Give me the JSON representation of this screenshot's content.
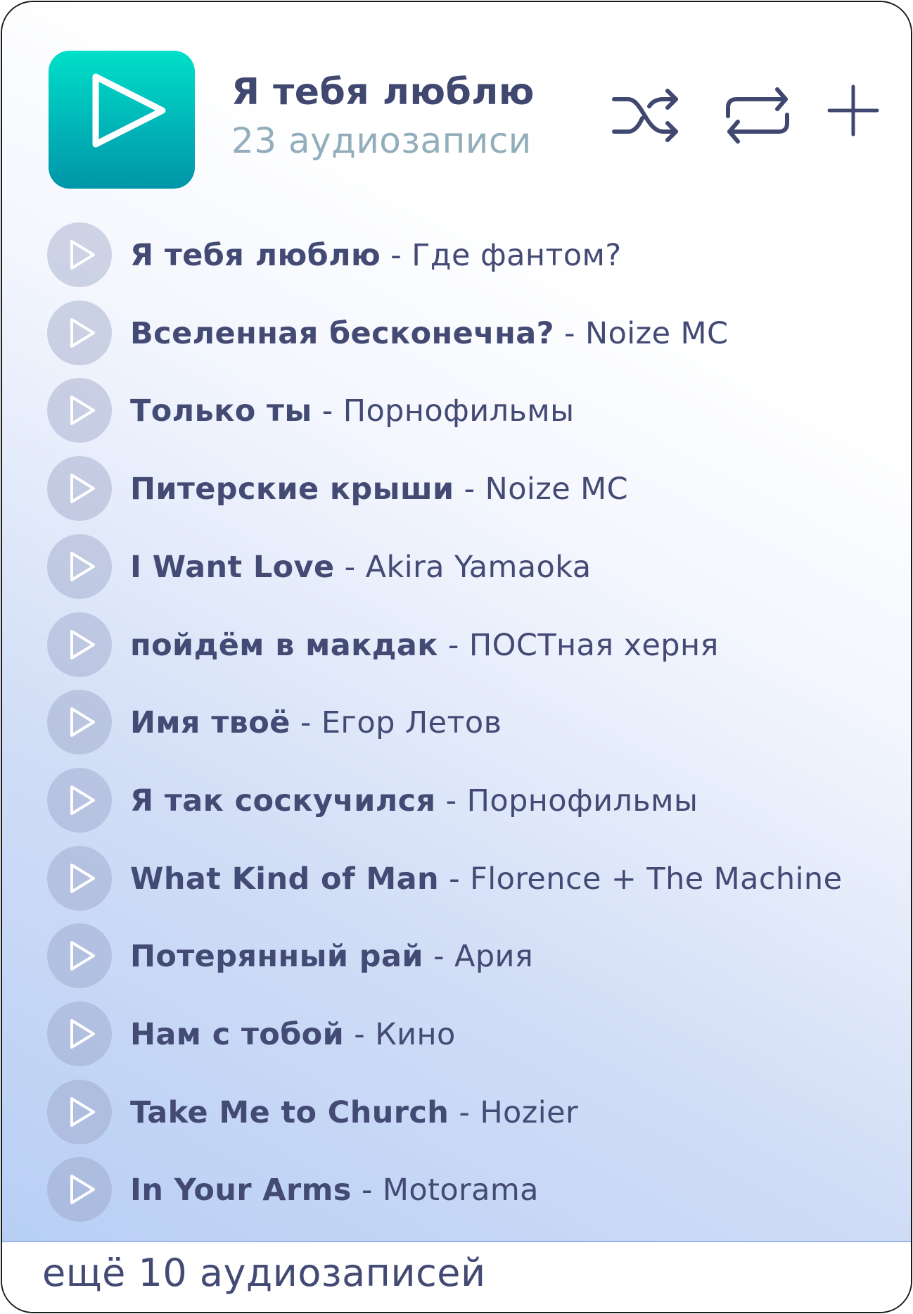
{
  "playlist": {
    "title": "Я тебя люблю",
    "count_label": "23 аудиозаписи"
  },
  "icons": {
    "cover": "play-icon",
    "shuffle": "shuffle-icon",
    "repeat": "repeat-icon",
    "add": "plus-icon",
    "row_play": "play-icon"
  },
  "colors": {
    "cover_top": "#00e0c8",
    "cover_bottom": "#0096a8",
    "title_text": "#414870",
    "subtitle_text": "#93aebb",
    "icon_stroke": "#414870",
    "divider": "#9ab5ea"
  },
  "separator": " - ",
  "tracks": [
    {
      "song": "Я тебя люблю",
      "artist": "Где фантом?"
    },
    {
      "song": "Вселенная бесконечна?",
      "artist": "Noize MC"
    },
    {
      "song": "Только ты",
      "artist": "Порнофильмы"
    },
    {
      "song": "Питерские крыши",
      "artist": "Noize MC"
    },
    {
      "song": "I Want Love",
      "artist": "Akira Yamaoka"
    },
    {
      "song": "пойдём в макдак",
      "artist": "ПОСТная херня"
    },
    {
      "song": "Имя твоё",
      "artist": "Егор Летов"
    },
    {
      "song": "Я так соскучился",
      "artist": "Порнофильмы"
    },
    {
      "song": "What Kind of Man",
      "artist": "Florence + The Machine"
    },
    {
      "song": "Потерянный рай",
      "artist": "Ария"
    },
    {
      "song": "Нам с тобой",
      "artist": "Кино"
    },
    {
      "song": "Take Me to Church",
      "artist": "Hozier"
    },
    {
      "song": "In Your Arms",
      "artist": "Motorama"
    }
  ],
  "footer": {
    "more_label": "ещё 10 аудиозаписей"
  }
}
